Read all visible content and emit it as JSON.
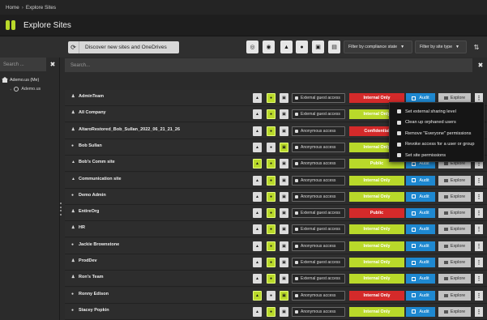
{
  "breadcrumb": {
    "home": "Home",
    "separator": "›",
    "current": "Explore Sites"
  },
  "header": {
    "title": "Explore Sites"
  },
  "toolbar": {
    "discover_label": "Discover new sites and OneDrives",
    "filter_compliance": "Filter by compliance state",
    "filter_site_type": "Filter by site type",
    "icons": [
      "target-icon",
      "eye-icon",
      "lock-icon",
      "user-icon",
      "user-square-icon",
      "document-icon"
    ]
  },
  "sidebar": {
    "search_placeholder": "Search ...",
    "tree_root": "Ademo.us (Me)",
    "tree_child": "Ademo.us"
  },
  "main": {
    "search_placeholder": "Search..."
  },
  "colors": {
    "accent_green": "#b9d92a",
    "status_red": "#d42a2a",
    "audit_blue": "#1e88d0"
  },
  "rows": [
    {
      "name": "AdminTeam",
      "type_icon": "group-icon",
      "access": "External guest access",
      "status": "Internal Only",
      "status_color": "#d42a2a",
      "active": [
        1
      ]
    },
    {
      "name": "All Company",
      "type_icon": "group-icon",
      "access": "External guest access",
      "status": "Internal Only",
      "status_color": "#b9d92a",
      "active": [
        1
      ]
    },
    {
      "name": "AltaroRestored_Bob_Sullan_2022_06_21_21_26",
      "type_icon": "group-icon",
      "access": "Anonymous access",
      "status": "Confidential",
      "status_color": "#d42a2a",
      "active": [
        1
      ]
    },
    {
      "name": "Bob Sullan",
      "type_icon": "user-icon",
      "access": "Anonymous access",
      "status": "Internal Only",
      "status_color": "#b9d92a",
      "active": [
        2
      ]
    },
    {
      "name": "Bob's Comm site",
      "type_icon": "site-icon",
      "access": "Anonymous access",
      "status": "Public",
      "status_color": "#b9d92a",
      "active": [
        0,
        1
      ]
    },
    {
      "name": "Communication site",
      "type_icon": "site-icon",
      "access": "Anonymous access",
      "status": "Internal Only",
      "status_color": "#b9d92a",
      "active": [
        1
      ]
    },
    {
      "name": "Demo Admin",
      "type_icon": "user-icon",
      "access": "Anonymous access",
      "status": "Internal Only",
      "status_color": "#b9d92a",
      "active": [
        1
      ]
    },
    {
      "name": "EntireOrg",
      "type_icon": "group-icon",
      "access": "External guest access",
      "status": "Public",
      "status_color": "#d42a2a",
      "active": [
        1
      ]
    },
    {
      "name": "HR",
      "type_icon": "group-icon",
      "access": "External guest access",
      "status": "Internal Only",
      "status_color": "#b9d92a",
      "active": [
        1
      ]
    },
    {
      "name": "Jackie Brownstone",
      "type_icon": "user-icon",
      "access": "Anonymous access",
      "status": "Internal Only",
      "status_color": "#b9d92a",
      "active": [
        1
      ]
    },
    {
      "name": "ProdDev",
      "type_icon": "group-icon",
      "access": "External guest access",
      "status": "Internal Only",
      "status_color": "#b9d92a",
      "active": [
        1
      ]
    },
    {
      "name": "Ron's Team",
      "type_icon": "group-icon",
      "access": "External guest access",
      "status": "Internal Only",
      "status_color": "#b9d92a",
      "active": [
        1
      ]
    },
    {
      "name": "Ronny Edison",
      "type_icon": "user-icon",
      "access": "Anonymous access",
      "status": "Internal Only",
      "status_color": "#d42a2a",
      "active": [
        0,
        2
      ]
    },
    {
      "name": "Stacey Popkin",
      "type_icon": "user-icon",
      "access": "Anonymous access",
      "status": "Internal Only",
      "status_color": "#b9d92a",
      "active": [
        1
      ]
    }
  ],
  "row_labels": {
    "audit": "Audit",
    "explore": "Explore",
    "more": "⋮"
  },
  "context_menu": {
    "items": [
      {
        "label": "Set external sharing level",
        "icon": "share-icon"
      },
      {
        "label": "Clean up orphaned users",
        "icon": "user-icon"
      },
      {
        "label": "Remove \"Everyone\" permissions",
        "icon": "users-remove-icon"
      },
      {
        "label": "Revoke access for a user or group",
        "icon": "revoke-icon"
      },
      {
        "label": "Set site permissions",
        "icon": "permissions-icon"
      }
    ]
  }
}
